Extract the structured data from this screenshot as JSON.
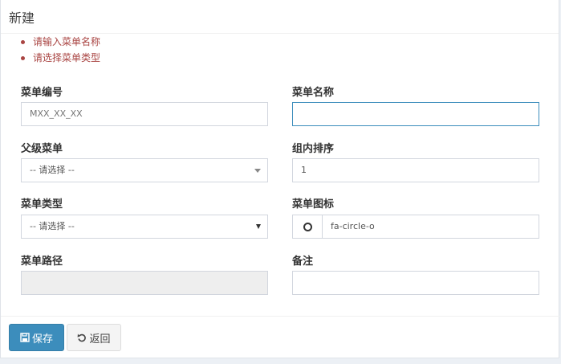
{
  "header": {
    "title": "新建"
  },
  "errors": [
    "请输入菜单名称",
    "请选择菜单类型"
  ],
  "form": {
    "code": {
      "label": "菜单编号",
      "placeholder": "MXX_XX_XX",
      "value": ""
    },
    "name": {
      "label": "菜单名称",
      "value": ""
    },
    "parent": {
      "label": "父级菜单",
      "selected": "-- 请选择 --"
    },
    "order": {
      "label": "组内排序",
      "value": "1"
    },
    "type": {
      "label": "菜单类型",
      "selected": "-- 请选择 --"
    },
    "icon": {
      "label": "菜单图标",
      "value": "fa-circle-o",
      "icon_name": "circle-o-icon"
    },
    "path": {
      "label": "菜单路径",
      "value": ""
    },
    "remark": {
      "label": "备注",
      "value": ""
    }
  },
  "actions": {
    "save_label": "保存",
    "back_label": "返回"
  },
  "colors": {
    "primary": "#3c8dbc",
    "error": "#a94442",
    "focus_border": "#3c8dbc"
  }
}
